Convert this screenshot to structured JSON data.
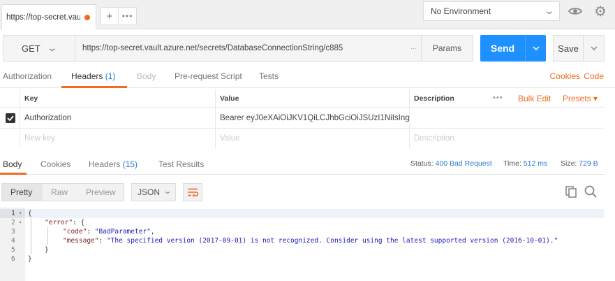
{
  "tabbar": {
    "tab_title": "https://top-secret.vau",
    "plus": "+",
    "more": "•••",
    "environment": "No Environment"
  },
  "request": {
    "method": "GET",
    "url": "https://top-secret.vault.azure.net/secrets/DatabaseConnectionString/c885",
    "url_more": "...",
    "params_label": "Params",
    "send_label": "Send",
    "save_label": "Save"
  },
  "request_tabs": {
    "items": [
      {
        "label": "Authorization"
      },
      {
        "label": "Headers ",
        "count": "(1)"
      },
      {
        "label": "Body"
      },
      {
        "label": "Pre-request Script"
      },
      {
        "label": "Tests"
      }
    ],
    "cookies": "Cookies",
    "code": "Code"
  },
  "headers_table": {
    "col_key": "Key",
    "col_value": "Value",
    "col_description": "Description",
    "more": "•••",
    "bulk_edit": "Bulk Edit",
    "presets": "Presets ▾",
    "rows": [
      {
        "key": "Authorization",
        "value": "Bearer eyJ0eXAiOiJKV1QiLCJhbGciOiJSUzI1NiIsIng...",
        "description": "",
        "checked": true
      }
    ],
    "new_row": {
      "key": "New key",
      "value": "Value",
      "description": "Description"
    }
  },
  "response_tabs": {
    "items": [
      {
        "label": "Body"
      },
      {
        "label": "Cookies"
      },
      {
        "label": "Headers ",
        "count": "(15)"
      },
      {
        "label": "Test Results"
      }
    ],
    "status_label": "Status:",
    "status_value": "400 Bad Request",
    "time_label": "Time:",
    "time_value": "512 ms",
    "size_label": "Size:",
    "size_value": "729 B"
  },
  "response_toolbar": {
    "views": [
      "Pretty",
      "Raw",
      "Preview"
    ],
    "format": "JSON"
  },
  "code": {
    "line_numbers": [
      "1",
      "2",
      "3",
      "4",
      "5",
      "6"
    ],
    "fold_markers": [
      "▾",
      "▾"
    ],
    "l1": "{",
    "l2_key": "\"error\"",
    "l2_rest": ": {",
    "l3_key": "\"code\"",
    "l3_sep": ": ",
    "l3_val": "\"BadParameter\"",
    "l3_end": ",",
    "l4_key": "\"message\"",
    "l4_sep": ": ",
    "l4_val": "\"The specified version (2017-09-01) is not recognized. Consider using the latest supported version (2016-10-01).\"",
    "l5": "}",
    "l6": "}"
  },
  "colors": {
    "accent": "#f26b21",
    "send_blue": "#1e90ff",
    "link_blue": "#2a7bd8"
  },
  "icons": {
    "env_chevron": "chevron-down-icon",
    "eye": "eye-icon",
    "gear": "gear-icon",
    "copy": "copy-icon",
    "search": "search-icon",
    "wrap": "wrap-lines-icon",
    "checkbox": "checkbox-checked-icon"
  }
}
